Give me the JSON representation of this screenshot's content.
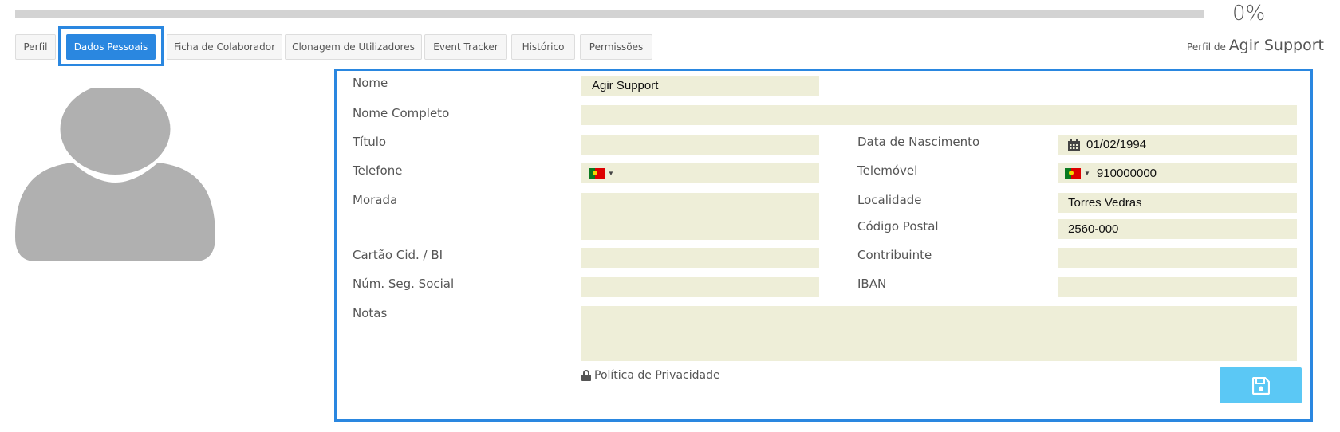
{
  "progress": {
    "label": "0%",
    "fraction": 0
  },
  "tabs": [
    {
      "label": "Perfil"
    },
    {
      "label": "Dados Pessoais",
      "active": true
    },
    {
      "label": "Ficha de Colaborador"
    },
    {
      "label": "Clonagem de Utilizadores"
    },
    {
      "label": "Event Tracker"
    },
    {
      "label": "Histórico"
    },
    {
      "label": "Permissões"
    }
  ],
  "header": {
    "profile_prefix": "Perfil de",
    "profile_name": "Agir Support"
  },
  "form": {
    "nome": {
      "label": "Nome",
      "value": "Agir Support"
    },
    "nome_completo": {
      "label": "Nome Completo",
      "value": ""
    },
    "titulo": {
      "label": "Título",
      "value": ""
    },
    "data_nascimento": {
      "label": "Data de Nascimento",
      "value": "01/02/1994"
    },
    "telefone": {
      "label": "Telefone",
      "value": ""
    },
    "telemovel": {
      "label": "Telemóvel",
      "value": "910000000"
    },
    "morada": {
      "label": "Morada",
      "value": ""
    },
    "localidade": {
      "label": "Localidade",
      "value": "Torres Vedras"
    },
    "codigo_postal": {
      "label": "Código Postal",
      "value": "2560-000"
    },
    "cartao_cid": {
      "label": "Cartão Cid. / BI",
      "value": ""
    },
    "contribuinte": {
      "label": "Contribuinte",
      "value": ""
    },
    "num_seg_social": {
      "label": "Núm. Seg. Social",
      "value": ""
    },
    "iban": {
      "label": "IBAN",
      "value": ""
    },
    "notas": {
      "label": "Notas",
      "value": ""
    }
  },
  "privacy_label": "Política de Privacidade",
  "icons": {
    "calendar": "calendar-icon",
    "lock": "lock-icon",
    "save": "floppy-disk-icon",
    "flag": "portugal-flag-icon"
  },
  "colors": {
    "accent": "#2a87e0",
    "field_bg": "#eeeed8",
    "save_button": "#5bc8f5",
    "avatar": "#b0b0b0"
  }
}
